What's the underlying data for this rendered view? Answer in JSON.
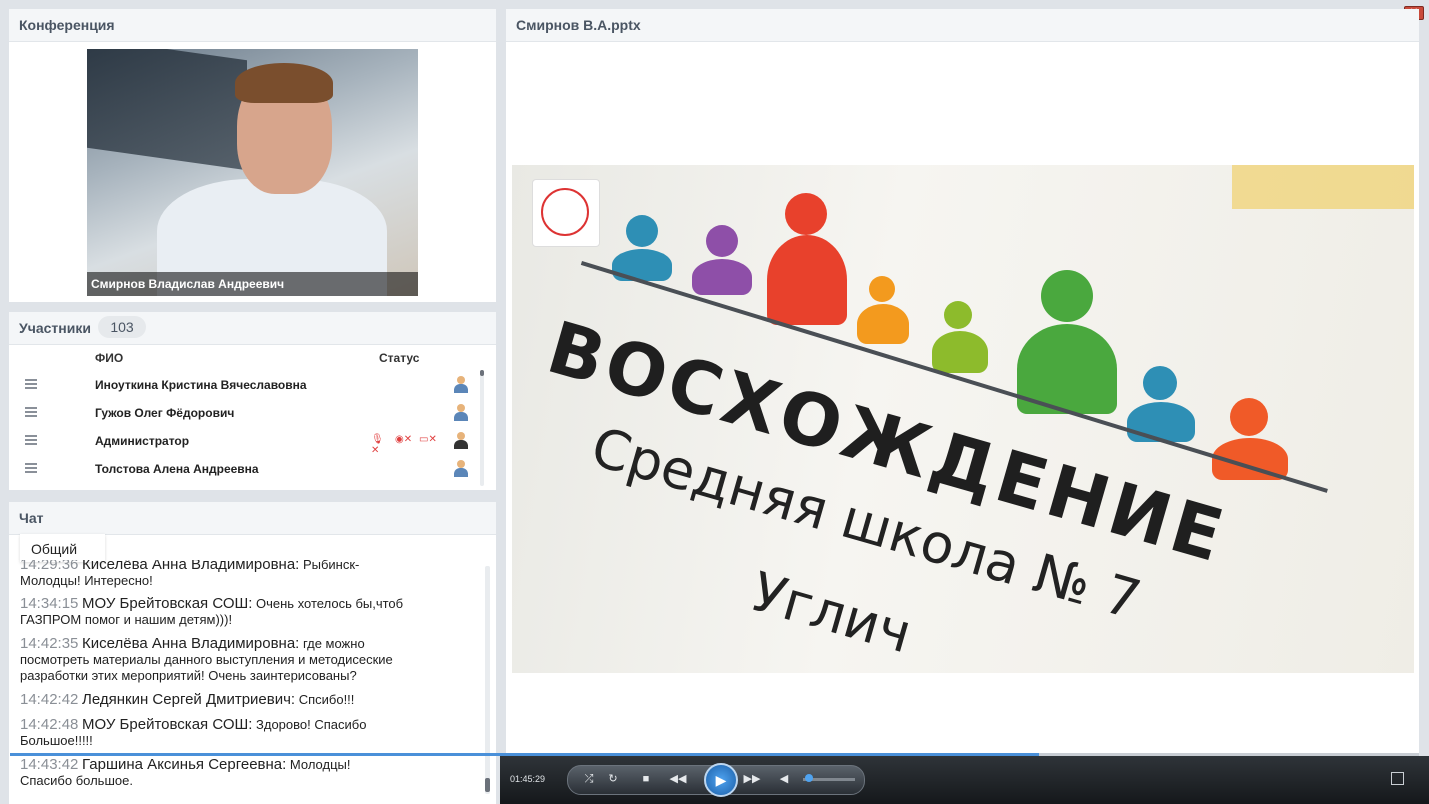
{
  "conference": {
    "title": "Конференция",
    "speaker_caption": "Смирнов  Владислав  Андреевич"
  },
  "participants": {
    "title": "Участники",
    "count": "103",
    "col_name": "ФИО",
    "col_status": "Статус",
    "rows": [
      {
        "name": "Иноуткина  Кристина Вячеславовна",
        "role": "user"
      },
      {
        "name": "Гужов Олег  Фёдорович",
        "role": "user"
      },
      {
        "name": "Администратор",
        "role": "admin"
      },
      {
        "name": "Толстова Алена  Андреевна",
        "role": "user"
      }
    ]
  },
  "chat": {
    "title": "Чат",
    "tab": "Общий",
    "messages": [
      {
        "time": "14:29:36",
        "author": "Киселёва Анна  Владимировна:",
        "text": " Рыбинск-\nМолодцы! Интересно!"
      },
      {
        "time": "14:34:15",
        "author": "МОУ Брейтовская СОШ:",
        "text": " Очень хотелось бы,чтоб\nГАЗПРОМ помог и нашим детям)))!"
      },
      {
        "time": "14:42:35",
        "author": "Киселёва Анна  Владимировна:",
        "text": " где можно\nпосмотреть материалы данного выступления и методисеские\nразработки этих мероприятий! Очень заинтерисованы?"
      },
      {
        "time": "14:42:42",
        "author": "Ледянкин Сергей  Дмитриевич:",
        "text": " Спсибо!!!"
      },
      {
        "time": "14:42:48",
        "author": "МОУ Брейтовская СОШ:",
        "text": " Здорово! Спасибо\nБольшое!!!!!"
      },
      {
        "time": "14:43:42",
        "author": "Гаршина  Аксинья   Сергеевна:",
        "text": " Молодцы!\nСпасибо большое."
      }
    ]
  },
  "presentation": {
    "title": "Смирнов В.А.pptx",
    "slide": {
      "word": "ВОСХОЖДЕНИЕ",
      "line1": "Средняя школа № 7",
      "line2": "Углич"
    }
  },
  "player": {
    "time": "01:45:29",
    "progress": 0.73,
    "volume": 0.05
  },
  "colors": {
    "accent": "#4a90d9",
    "figure_colors": [
      "#2e8fb5",
      "#8e4fa8",
      "#e8412c",
      "#f39a1e",
      "#8dbb2c",
      "#4aa83e",
      "#2e8fb5",
      "#f05a28"
    ]
  },
  "icons": {
    "menu": "hamburger-icon",
    "user": "user-icon",
    "close": "close-icon"
  }
}
